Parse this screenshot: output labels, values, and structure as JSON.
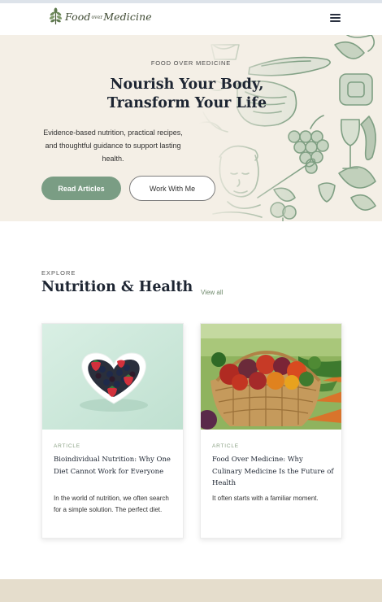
{
  "header": {
    "logo": {
      "part1": "Food",
      "small": "over",
      "part2": "Medicine"
    },
    "menu_icon": "hamburger-menu-icon"
  },
  "hero": {
    "eyebrow": "FOOD OVER MEDICINE",
    "title_line1": "Nourish Your Body,",
    "title_line2": "Transform Your Life",
    "subtitle": "Evidence-based nutrition, practical recipes, and thoughtful guidance to support lasting health.",
    "primary_button": "Read Articles",
    "secondary_button": "Work With Me"
  },
  "section": {
    "eyebrow": "EXPLORE",
    "title": "Nutrition & Health",
    "view_all": "View all"
  },
  "cards": [
    {
      "tag": "ARTICLE",
      "title": "Bioindividual Nutrition: Why One Diet Cannot Work for Everyone",
      "excerpt": "In the world of nutrition, we often search for a simple solution. The perfect diet."
    },
    {
      "tag": "ARTICLE",
      "title": "Food Over Medicine: Why Culinary Medicine Is the Future of Health",
      "excerpt": "It often starts with a familiar moment."
    }
  ],
  "colors": {
    "accent_green": "#7a9d84",
    "hero_bg": "#f4efe6",
    "footer_band": "#e5ddcc",
    "heading": "#1d2532"
  }
}
